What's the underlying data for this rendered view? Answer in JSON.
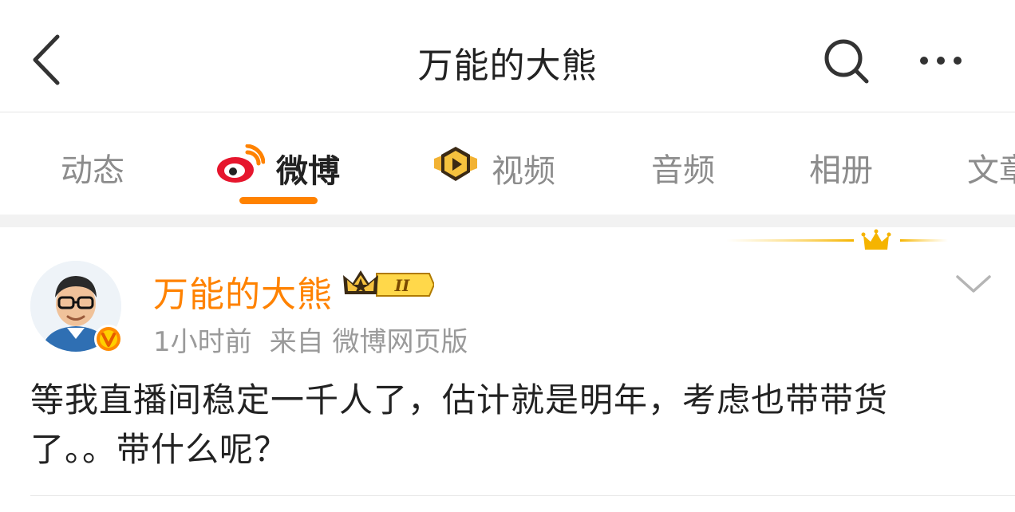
{
  "header": {
    "title": "万能的大熊"
  },
  "tabs": [
    {
      "label": "动态"
    },
    {
      "label": "微博"
    },
    {
      "label": "视频"
    },
    {
      "label": "音频"
    },
    {
      "label": "相册"
    },
    {
      "label": "文章"
    }
  ],
  "active_tab": "微博",
  "post": {
    "username": "万能的大熊",
    "level_badge": "II",
    "time": "1小时前",
    "source": "来自 微博网页版",
    "text": "等我直播间稳定一千人了，估计就是明年，考虑也带带货了。。带什么呢？"
  },
  "colors": {
    "accent": "#ff8200",
    "text": "#222222",
    "muted": "#8c8c8c"
  }
}
